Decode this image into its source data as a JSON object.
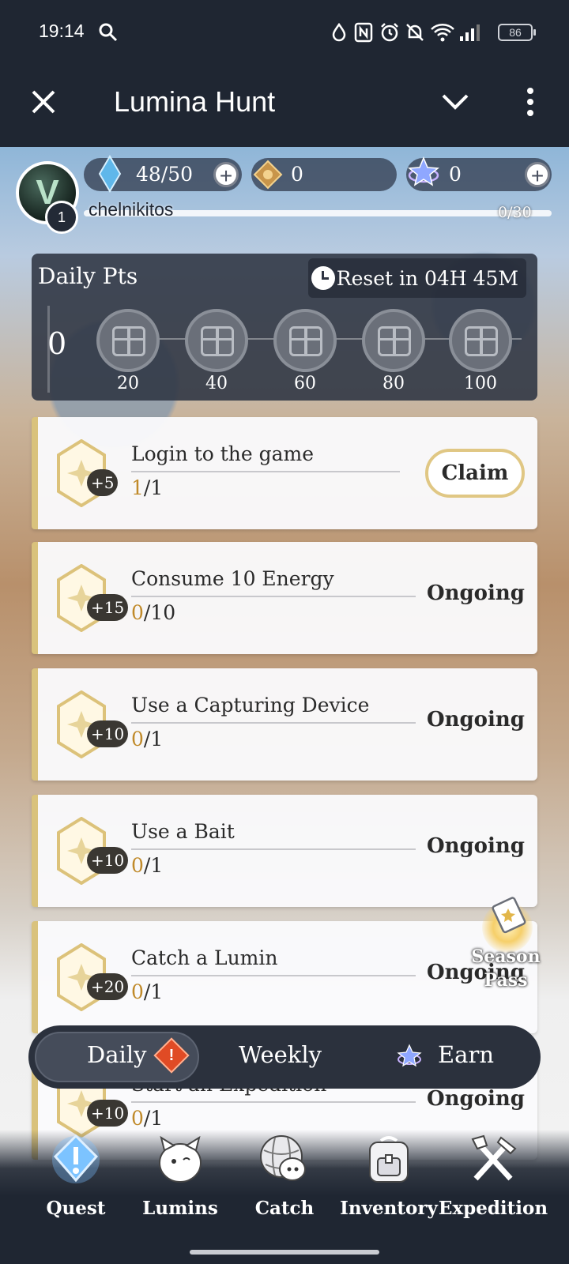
{
  "status_bar": {
    "time": "19:14",
    "battery": "86",
    "icons": [
      "search-icon",
      "drop-icon",
      "nfc-icon",
      "alarm-icon",
      "mute-icon",
      "wifi-icon",
      "signal-icon"
    ]
  },
  "app_bar": {
    "title": "Lumina Hunt",
    "icons": [
      "close-icon",
      "chevron-down-icon",
      "more-vert-icon"
    ]
  },
  "player": {
    "avatar_letter": "V",
    "level": "1",
    "name": "chelnikitos",
    "xp": "0/30",
    "energy": "48/50",
    "coins": "0",
    "stars": "0"
  },
  "daily_points": {
    "label": "Daily Pts",
    "reset": "Reset in 04H 45M",
    "value": "0",
    "milestones": [
      "20",
      "40",
      "60",
      "80",
      "100"
    ]
  },
  "quests": [
    {
      "points": "+5",
      "title": "Login to the game",
      "current": "1",
      "total": "/1",
      "status": "Claim"
    },
    {
      "points": "+15",
      "title": "Consume 10 Energy",
      "current": "0",
      "total": "/10",
      "status": "Ongoing"
    },
    {
      "points": "+10",
      "title": "Use a Capturing Device",
      "current": "0",
      "total": "/1",
      "status": "Ongoing"
    },
    {
      "points": "+10",
      "title": "Use a Bait",
      "current": "0",
      "total": "/1",
      "status": "Ongoing"
    },
    {
      "points": "+20",
      "title": "Catch a Lumin",
      "current": "0",
      "total": "/1",
      "status": "Ongoing"
    },
    {
      "points": "+10",
      "title": "Start an Expedition",
      "current": "0",
      "total": "/1",
      "status": "Ongoing"
    }
  ],
  "season_pass": "Season Pass",
  "tabs": {
    "daily": "Daily",
    "weekly": "Weekly",
    "earn": "Earn",
    "alert": "!"
  },
  "nav": {
    "quest": "Quest",
    "lumins": "Lumins",
    "catch": "Catch",
    "inventory": "Inventory",
    "expedition": "Expedition"
  },
  "colors": {
    "bar": "#1f2632",
    "gold": "#d9c27c",
    "progress_current": "#c08a2a",
    "alert": "#e04b25"
  }
}
